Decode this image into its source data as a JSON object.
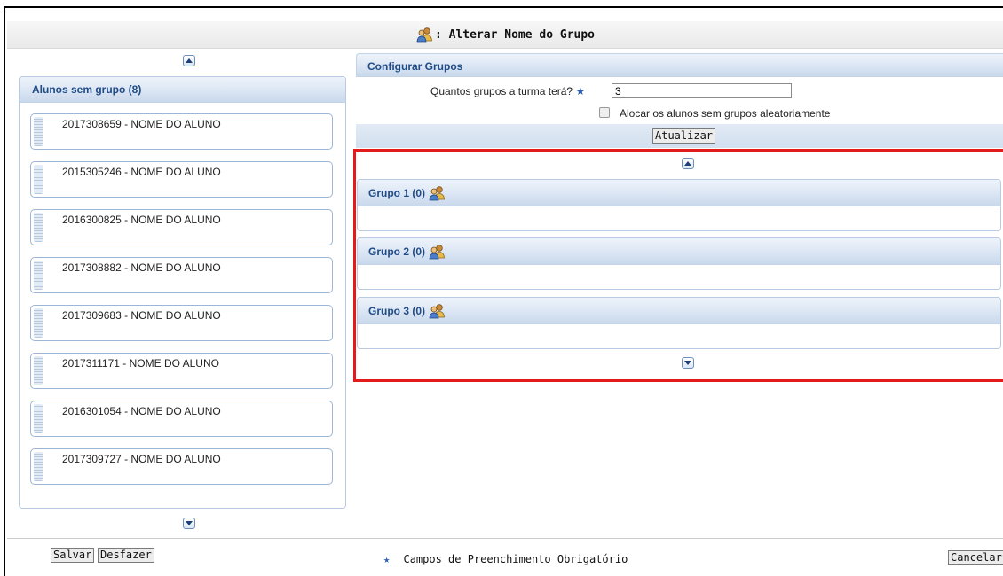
{
  "title": {
    "text": ": Alterar Nome do Grupo"
  },
  "left_panel": {
    "header": "Alunos sem grupo (8)",
    "students": [
      "2017308659 - NOME DO ALUNO",
      "2015305246 - NOME DO ALUNO",
      "2016300825 - NOME DO ALUNO",
      "2017308882 - NOME DO ALUNO",
      "2017309683 - NOME DO ALUNO",
      "2017311171 - NOME DO ALUNO",
      "2016301054 - NOME DO ALUNO",
      "2017309727 - NOME DO ALUNO"
    ]
  },
  "config": {
    "header": "Configurar Grupos",
    "question_label": "Quantos grupos a turma terá?",
    "required_star": "★",
    "group_count_value": "3",
    "random_checkbox_label": "Alocar os alunos sem grupos aleatoriamente",
    "random_checkbox_checked": false,
    "update_button": "Atualizar"
  },
  "groups": [
    {
      "label": "Grupo 1 (0)"
    },
    {
      "label": "Grupo 2 (0)"
    },
    {
      "label": "Grupo 3 (0)"
    }
  ],
  "footer": {
    "save_button": "Salvar",
    "undo_button": "Desfazer",
    "required_note": "Campos de Preenchimento Obrigatório",
    "cancel_button": "Cancelar"
  },
  "colors": {
    "header_text": "#1f4b87",
    "highlight_border": "#e41b1b",
    "panel_border": "#b8cbe2"
  },
  "icons": {
    "group": "group-users-icon",
    "scroll_up": "chevron-up-icon",
    "scroll_down": "chevron-down-icon",
    "drag": "drag-handle-icon"
  }
}
